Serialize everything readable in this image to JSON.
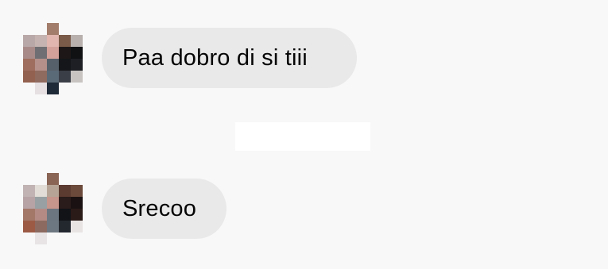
{
  "messages": [
    {
      "text": "Paa dobro di si tiii",
      "sender_avatar": "pixelated-avatar"
    },
    {
      "text": "Srecoo",
      "sender_avatar": "pixelated-avatar"
    }
  ],
  "colors": {
    "background": "#f8f8f8",
    "bubble": "#e9e9e9",
    "text": "#050505",
    "redaction_box": "#ffffff"
  }
}
